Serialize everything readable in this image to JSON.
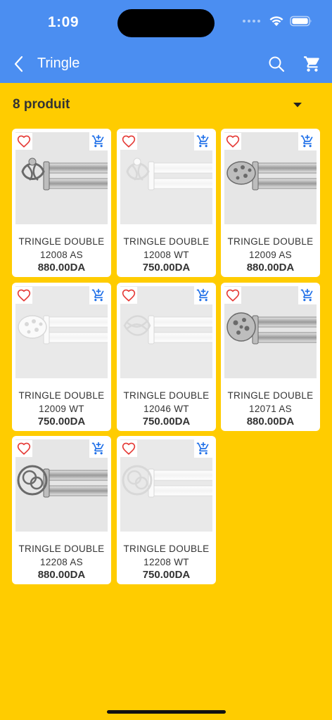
{
  "status_bar": {
    "time": "1:09"
  },
  "app_bar": {
    "title": "Tringle",
    "back_icon": "chevron-left-icon",
    "search_icon": "search-icon",
    "cart_icon": "cart-icon"
  },
  "listing": {
    "count_label": "8 produit",
    "sort_icon": "caret-down-icon"
  },
  "colors": {
    "primary": "#4B8EF1",
    "background": "#FFCC00",
    "favorite": "#E53935",
    "cart_accent": "#1E6FE8"
  },
  "products": [
    {
      "name_line1": "TRINGLE DOUBLE",
      "name_line2": "12008 AS",
      "price": "880.00DA",
      "finish": "chrome",
      "finial": "cage"
    },
    {
      "name_line1": "TRINGLE DOUBLE",
      "name_line2": "12008 WT",
      "price": "750.00DA",
      "finish": "white",
      "finial": "cage"
    },
    {
      "name_line1": "TRINGLE DOUBLE",
      "name_line2": "12009 AS",
      "price": "880.00DA",
      "finish": "chrome",
      "finial": "egg"
    },
    {
      "name_line1": "TRINGLE DOUBLE",
      "name_line2": "12009 WT",
      "price": "750.00DA",
      "finish": "white",
      "finial": "egg"
    },
    {
      "name_line1": "TRINGLE DOUBLE",
      "name_line2": "12046 WT",
      "price": "750.00DA",
      "finish": "white",
      "finial": "spiral"
    },
    {
      "name_line1": "TRINGLE DOUBLE",
      "name_line2": "12071 AS",
      "price": "880.00DA",
      "finish": "chrome",
      "finial": "ball"
    },
    {
      "name_line1": "TRINGLE DOUBLE",
      "name_line2": "12208 AS",
      "price": "880.00DA",
      "finish": "chrome",
      "finial": "rings"
    },
    {
      "name_line1": "TRINGLE DOUBLE",
      "name_line2": "12208 WT",
      "price": "750.00DA",
      "finish": "white",
      "finial": "rings"
    }
  ]
}
